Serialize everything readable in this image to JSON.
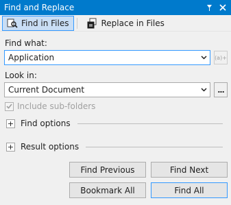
{
  "window": {
    "title": "Find and Replace",
    "controls": [
      "pin-icon",
      "close-icon"
    ]
  },
  "tabs": [
    {
      "label": "Find in Files",
      "icon": "find-in-files-icon",
      "active": true
    },
    {
      "label": "Replace in Files",
      "icon": "replace-in-files-icon",
      "active": false
    }
  ],
  "find": {
    "label": "Find what:",
    "value": "Application",
    "regex_button": "(a)+"
  },
  "lookin": {
    "label": "Look in:",
    "value": "Current Document",
    "browse_label": "..."
  },
  "include_subfolders": {
    "label": "Include sub-folders",
    "checked": true,
    "enabled": false
  },
  "sections": {
    "find_options": "Find options",
    "result_options": "Result options"
  },
  "buttons": {
    "find_previous": "Find Previous",
    "find_next": "Find Next",
    "bookmark_all": "Bookmark All",
    "find_all": "Find All"
  },
  "colors": {
    "accent": "#007acc",
    "focus_border": "#3399ff",
    "tab_active_bg": "#c9def5"
  }
}
